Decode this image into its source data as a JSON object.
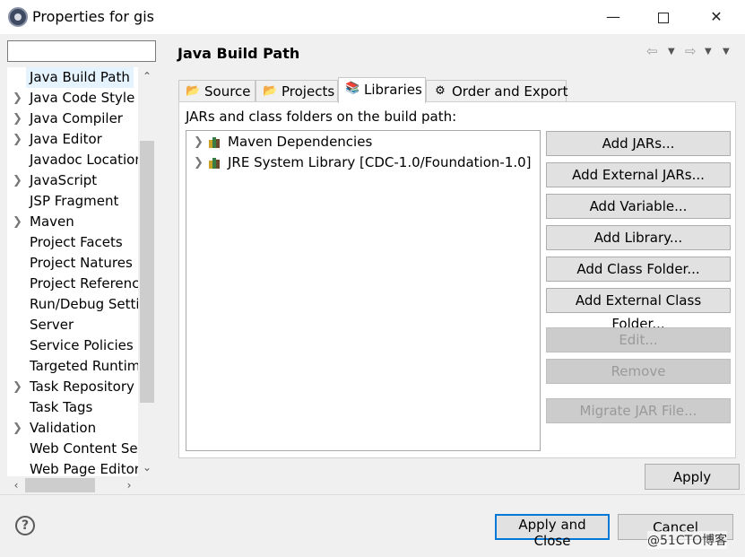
{
  "window": {
    "title": "Properties for gis",
    "minimize": "—",
    "close": "✕"
  },
  "filter": {
    "value": "",
    "placeholder": ""
  },
  "tree": {
    "items": [
      {
        "label": "Java Build Path",
        "expandable": false,
        "selected": true
      },
      {
        "label": "Java Code Style",
        "expandable": true
      },
      {
        "label": "Java Compiler",
        "expandable": true
      },
      {
        "label": "Java Editor",
        "expandable": true
      },
      {
        "label": "Javadoc Location",
        "expandable": false
      },
      {
        "label": "JavaScript",
        "expandable": true
      },
      {
        "label": "JSP Fragment",
        "expandable": false
      },
      {
        "label": "Maven",
        "expandable": true
      },
      {
        "label": "Project Facets",
        "expandable": false
      },
      {
        "label": "Project Natures",
        "expandable": false
      },
      {
        "label": "Project References",
        "expandable": false
      },
      {
        "label": "Run/Debug Settings",
        "expandable": false
      },
      {
        "label": "Server",
        "expandable": false
      },
      {
        "label": "Service Policies",
        "expandable": false
      },
      {
        "label": "Targeted Runtimes",
        "expandable": false
      },
      {
        "label": "Task Repository",
        "expandable": true
      },
      {
        "label": "Task Tags",
        "expandable": false
      },
      {
        "label": "Validation",
        "expandable": true
      },
      {
        "label": "Web Content Settings",
        "expandable": false
      },
      {
        "label": "Web Page Editor",
        "expandable": false
      }
    ]
  },
  "page": {
    "title": "Java Build Path",
    "tabs": [
      "Source",
      "Projects",
      "Libraries",
      "Order and Export"
    ],
    "active_tab": "Libraries",
    "caption": "JARs and class folders on the build path:",
    "libraries": [
      "Maven Dependencies",
      "JRE System Library [CDC-1.0/Foundation-1.0]"
    ]
  },
  "buttons": {
    "add_jars": "Add JARs...",
    "add_external_jars": "Add External JARs...",
    "add_variable": "Add Variable...",
    "add_library": "Add Library...",
    "add_class_folder": "Add Class Folder...",
    "add_external_class_folder": "Add External Class Folder...",
    "edit": "Edit...",
    "remove": "Remove",
    "migrate_jar": "Migrate JAR File..."
  },
  "footer": {
    "apply": "Apply",
    "apply_and_close": "Apply and Close",
    "cancel": "Cancel",
    "help": "?",
    "watermark": "@51CTO博客"
  }
}
